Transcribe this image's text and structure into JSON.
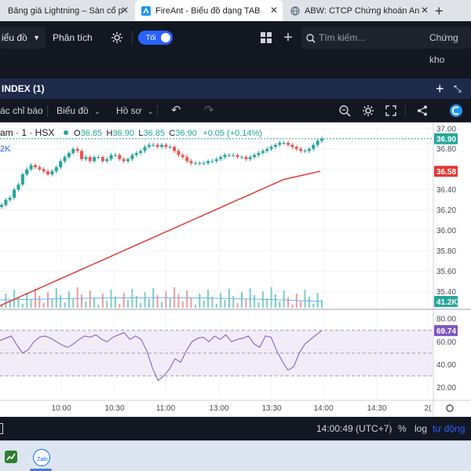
{
  "browser": {
    "tabs": [
      {
        "title": "Bảng giá Lightning – Sàn cổ phiế",
        "active": false
      },
      {
        "title": "FireAnt - Biểu đồ dạng TAB",
        "active": true
      },
      {
        "title": "ABW: CTCP Chứng khoán An Bình",
        "active": false
      }
    ]
  },
  "appbar": {
    "chart_menu": "iểu đồ",
    "analysis": "Phân tích",
    "toggle_label": "Tối",
    "search_placeholder": "Tìm kiếm...",
    "right_label": "Chứng kho"
  },
  "panel": {
    "title": "INDEX (1)"
  },
  "chart_toolbar": {
    "indicators": "ác chỉ báo",
    "chart": "Biểu đồ",
    "profile": "Hồ sơ"
  },
  "legend": {
    "symbol": "am · 1 · HSX",
    "o_label": "O",
    "o_value": "36.85",
    "h_label": "H",
    "h_value": "36.90",
    "l_label": "L",
    "l_value": "36.85",
    "c_label": "C",
    "c_value": "36.90",
    "change": "+0.05 (+0.14%)",
    "volume_partial": "2K"
  },
  "colors": {
    "up": "#26a69a",
    "down": "#ef5350",
    "ma": "#e53935",
    "rsi": "#7e57c2",
    "dark": "#131722"
  },
  "chart_data": {
    "type": "candlestick",
    "x_ticks": [
      "10:00",
      "10:30",
      "11:00",
      "13:00",
      "13:30",
      "14:00",
      "14:30",
      "2("
    ],
    "price_axis": [
      "37.00",
      "36.80",
      "36.60",
      "36.40",
      "36.20",
      "36.00",
      "35.80",
      "35.60",
      "35.40"
    ],
    "price_range": [
      35.24,
      37.06
    ],
    "price_badges": [
      {
        "value": "36.90",
        "kind": "last"
      },
      {
        "value": "36.58",
        "kind": "ma"
      }
    ],
    "volume_badge": "41.2K",
    "rsi_axis": [
      "80.00",
      "60.00",
      "40.00",
      "20.00"
    ],
    "rsi_range": [
      10,
      87
    ],
    "rsi_band": [
      30,
      70
    ],
    "rsi_badge": "69.74",
    "close": [
      36.25,
      36.3,
      36.32,
      36.4,
      36.45,
      36.55,
      36.6,
      36.64,
      36.62,
      36.6,
      36.58,
      36.55,
      36.58,
      36.62,
      36.68,
      36.72,
      36.76,
      36.8,
      36.78,
      36.7,
      36.72,
      36.68,
      36.72,
      36.72,
      36.68,
      36.7,
      36.74,
      36.74,
      36.7,
      36.68,
      36.7,
      36.74,
      36.76,
      36.78,
      36.82,
      36.84,
      36.84,
      36.82,
      36.84,
      36.82,
      36.82,
      36.78,
      36.74,
      36.72,
      36.68,
      36.66,
      36.66,
      36.66,
      36.66,
      36.68,
      36.68,
      36.7,
      36.72,
      36.74,
      36.74,
      36.74,
      36.72,
      36.72,
      36.7,
      36.72,
      36.74,
      36.76,
      36.78,
      36.8,
      36.82,
      36.84,
      36.86,
      36.86,
      36.84,
      36.82,
      36.8,
      36.78,
      36.78,
      36.8,
      36.84,
      36.88,
      36.9
    ],
    "ma": [
      35.26,
      35.3,
      35.34,
      35.38,
      35.42,
      35.46,
      35.5,
      35.54,
      35.58,
      35.62,
      35.66,
      35.7,
      35.74,
      35.78,
      35.82,
      35.86,
      35.9,
      35.94,
      35.98,
      36.02,
      36.06,
      36.1,
      36.14,
      36.18,
      36.22,
      36.26,
      36.3,
      36.34,
      36.38,
      36.42,
      36.46,
      36.5,
      36.52,
      36.54,
      36.56,
      36.58
    ],
    "rsi": [
      61,
      63,
      65,
      57,
      50,
      53,
      60,
      64,
      65,
      63,
      60,
      57,
      55,
      58,
      62,
      65,
      64,
      66,
      62,
      60,
      64,
      66,
      68,
      62,
      65,
      62,
      52,
      37,
      26,
      30,
      36,
      45,
      42,
      52,
      60,
      63,
      64,
      60,
      65,
      62,
      66,
      60,
      62,
      63,
      65,
      58,
      55,
      65,
      64,
      52,
      43,
      35,
      38,
      50,
      58,
      62,
      66,
      69.74
    ]
  },
  "footer": {
    "time": "14:00:49 (UTC+7)",
    "percent": "%",
    "log": "log",
    "auto": "tự động"
  }
}
